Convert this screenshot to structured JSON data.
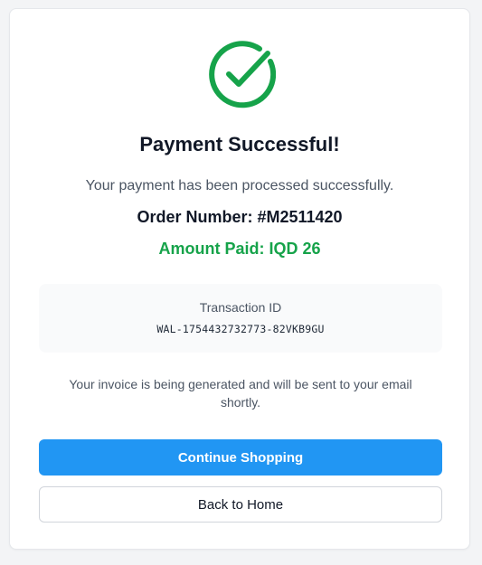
{
  "colors": {
    "success": "#16a34a",
    "primary": "#2196f3"
  },
  "icon": "check-circle-icon",
  "title": "Payment Successful!",
  "subtitle": "Your payment has been processed successfully.",
  "order_number": "Order Number: #M2511420",
  "amount_paid": "Amount Paid: IQD 26",
  "transaction": {
    "label": "Transaction ID",
    "value": "WAL-1754432732773-82VKB9GU"
  },
  "invoice_message": "Your invoice is being generated and will be sent to your email shortly.",
  "buttons": {
    "continue_label": "Continue Shopping",
    "home_label": "Back to Home"
  }
}
